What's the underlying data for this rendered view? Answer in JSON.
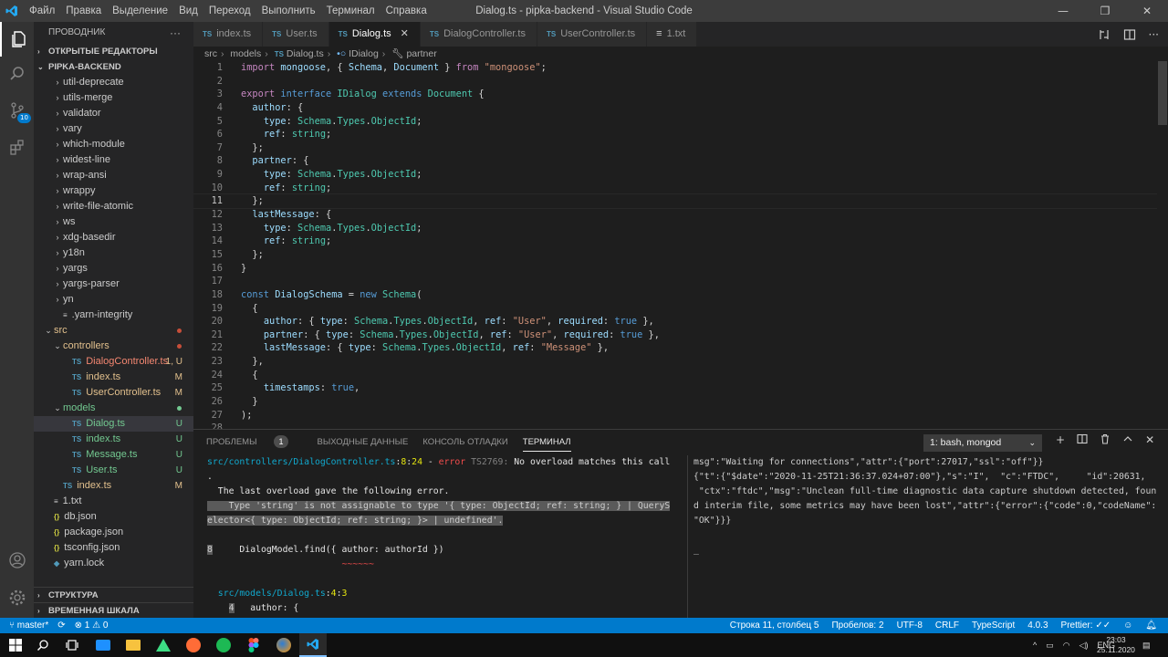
{
  "window": {
    "title": "Dialog.ts - pipka-backend - Visual Studio Code",
    "menu": [
      "Файл",
      "Правка",
      "Выделение",
      "Вид",
      "Переход",
      "Выполнить",
      "Терминал",
      "Справка"
    ],
    "controls": {
      "minimize": "—",
      "maximize": "❐",
      "close": "✕"
    }
  },
  "activity": {
    "scm_badge": "10"
  },
  "sidebar": {
    "title": "ПРОВОДНИК",
    "more": "···",
    "open_editors": "ОТКРЫТЫЕ РЕДАКТОРЫ",
    "project": "PIPKA-BACKEND",
    "outline": "СТРУКТУРА",
    "timeline": "ВРЕМЕННАЯ ШКАЛА",
    "items": [
      {
        "label": "util-deprecate",
        "type": "folder",
        "indent": 1
      },
      {
        "label": "utils-merge",
        "type": "folder",
        "indent": 1
      },
      {
        "label": "validator",
        "type": "folder",
        "indent": 1
      },
      {
        "label": "vary",
        "type": "folder",
        "indent": 1
      },
      {
        "label": "which-module",
        "type": "folder",
        "indent": 1
      },
      {
        "label": "widest-line",
        "type": "folder",
        "indent": 1
      },
      {
        "label": "wrap-ansi",
        "type": "folder",
        "indent": 1
      },
      {
        "label": "wrappy",
        "type": "folder",
        "indent": 1
      },
      {
        "label": "write-file-atomic",
        "type": "folder",
        "indent": 1
      },
      {
        "label": "ws",
        "type": "folder",
        "indent": 1
      },
      {
        "label": "xdg-basedir",
        "type": "folder",
        "indent": 1
      },
      {
        "label": "y18n",
        "type": "folder",
        "indent": 1
      },
      {
        "label": "yargs",
        "type": "folder",
        "indent": 1
      },
      {
        "label": "yargs-parser",
        "type": "folder",
        "indent": 1
      },
      {
        "label": "yn",
        "type": "folder",
        "indent": 1
      },
      {
        "label": ".yarn-integrity",
        "type": "file",
        "indent": 1
      },
      {
        "label": "src",
        "type": "open",
        "indent": 0,
        "color": "#e2c08d",
        "dot": "#c74e39"
      },
      {
        "label": "controllers",
        "type": "open",
        "indent": 1,
        "color": "#e2c08d",
        "dot": "#c74e39"
      },
      {
        "label": "DialogController.ts",
        "type": "ts",
        "indent": 2,
        "color": "#f48771",
        "badge": "1, U",
        "badgeColor": "#e2c08d"
      },
      {
        "label": "index.ts",
        "type": "ts",
        "indent": 2,
        "color": "#e2c08d",
        "badge": "M",
        "badgeColor": "#e2c08d"
      },
      {
        "label": "UserController.ts",
        "type": "ts",
        "indent": 2,
        "color": "#e2c08d",
        "badge": "M",
        "badgeColor": "#e2c08d"
      },
      {
        "label": "models",
        "type": "open",
        "indent": 1,
        "color": "#73c991",
        "dot": "#73c991"
      },
      {
        "label": "Dialog.ts",
        "type": "ts",
        "indent": 2,
        "color": "#73c991",
        "badge": "U",
        "badgeColor": "#73c991",
        "selected": true
      },
      {
        "label": "index.ts",
        "type": "ts",
        "indent": 2,
        "color": "#73c991",
        "badge": "U",
        "badgeColor": "#73c991"
      },
      {
        "label": "Message.ts",
        "type": "ts",
        "indent": 2,
        "color": "#73c991",
        "badge": "U",
        "badgeColor": "#73c991"
      },
      {
        "label": "User.ts",
        "type": "ts",
        "indent": 2,
        "color": "#73c991",
        "badge": "U",
        "badgeColor": "#73c991"
      },
      {
        "label": "index.ts",
        "type": "ts",
        "indent": 1,
        "color": "#e2c08d",
        "badge": "M",
        "badgeColor": "#e2c08d"
      },
      {
        "label": "1.txt",
        "type": "txt",
        "indent": 0
      },
      {
        "label": "db.json",
        "type": "json",
        "indent": 0
      },
      {
        "label": "package.json",
        "type": "json",
        "indent": 0
      },
      {
        "label": "tsconfig.json",
        "type": "json",
        "indent": 0
      },
      {
        "label": "yarn.lock",
        "type": "lock",
        "indent": 0
      }
    ]
  },
  "tabs": [
    {
      "label": "index.ts",
      "icon": "TS"
    },
    {
      "label": "User.ts",
      "icon": "TS"
    },
    {
      "label": "Dialog.ts",
      "icon": "TS",
      "active": true,
      "close": "✕"
    },
    {
      "label": "DialogController.ts",
      "icon": "TS"
    },
    {
      "label": "UserController.ts",
      "icon": "TS"
    },
    {
      "label": "1.txt",
      "icon": "≡"
    }
  ],
  "breadcrumb": [
    "src",
    "models",
    "Dialog.ts",
    "IDialog",
    "partner"
  ],
  "code": [
    [
      [
        "kw2",
        "import"
      ],
      [
        "pr",
        " mongoose"
      ],
      [
        "pu",
        ", { "
      ],
      [
        "pr",
        "Schema"
      ],
      [
        "pu",
        ", "
      ],
      [
        "pr",
        "Document"
      ],
      [
        "pu",
        " } "
      ],
      [
        "kw2",
        "from"
      ],
      [
        "pu",
        " "
      ],
      [
        "st",
        "\"mongoose\""
      ],
      [
        "pu",
        ";"
      ]
    ],
    [],
    [
      [
        "kw2",
        "export"
      ],
      [
        "pu",
        " "
      ],
      [
        "kw",
        "interface"
      ],
      [
        "pu",
        " "
      ],
      [
        "ty",
        "IDialog"
      ],
      [
        "pu",
        " "
      ],
      [
        "kw",
        "extends"
      ],
      [
        "pu",
        " "
      ],
      [
        "ty",
        "Document"
      ],
      [
        "pu",
        " {"
      ]
    ],
    [
      [
        "pu",
        "  "
      ],
      [
        "pr",
        "author"
      ],
      [
        "pu",
        ": {"
      ]
    ],
    [
      [
        "pu",
        "    "
      ],
      [
        "pr",
        "type"
      ],
      [
        "pu",
        ": "
      ],
      [
        "ty",
        "Schema"
      ],
      [
        "pu",
        "."
      ],
      [
        "ty",
        "Types"
      ],
      [
        "pu",
        "."
      ],
      [
        "ty",
        "ObjectId"
      ],
      [
        "pu",
        ";"
      ]
    ],
    [
      [
        "pu",
        "    "
      ],
      [
        "pr",
        "ref"
      ],
      [
        "pu",
        ": "
      ],
      [
        "ty",
        "string"
      ],
      [
        "pu",
        ";"
      ]
    ],
    [
      [
        "pu",
        "  };"
      ]
    ],
    [
      [
        "pu",
        "  "
      ],
      [
        "pr",
        "partner"
      ],
      [
        "pu",
        ": {"
      ]
    ],
    [
      [
        "pu",
        "    "
      ],
      [
        "pr",
        "type"
      ],
      [
        "pu",
        ": "
      ],
      [
        "ty",
        "Schema"
      ],
      [
        "pu",
        "."
      ],
      [
        "ty",
        "Types"
      ],
      [
        "pu",
        "."
      ],
      [
        "ty",
        "ObjectId"
      ],
      [
        "pu",
        ";"
      ]
    ],
    [
      [
        "pu",
        "    "
      ],
      [
        "pr",
        "ref"
      ],
      [
        "pu",
        ": "
      ],
      [
        "ty",
        "string"
      ],
      [
        "pu",
        ";"
      ]
    ],
    [
      [
        "pu",
        "  };"
      ]
    ],
    [
      [
        "pu",
        "  "
      ],
      [
        "pr",
        "lastMessage"
      ],
      [
        "pu",
        ": {"
      ]
    ],
    [
      [
        "pu",
        "    "
      ],
      [
        "pr",
        "type"
      ],
      [
        "pu",
        ": "
      ],
      [
        "ty",
        "Schema"
      ],
      [
        "pu",
        "."
      ],
      [
        "ty",
        "Types"
      ],
      [
        "pu",
        "."
      ],
      [
        "ty",
        "ObjectId"
      ],
      [
        "pu",
        ";"
      ]
    ],
    [
      [
        "pu",
        "    "
      ],
      [
        "pr",
        "ref"
      ],
      [
        "pu",
        ": "
      ],
      [
        "ty",
        "string"
      ],
      [
        "pu",
        ";"
      ]
    ],
    [
      [
        "pu",
        "  };"
      ]
    ],
    [
      [
        "pu",
        "}"
      ]
    ],
    [],
    [
      [
        "kw",
        "const"
      ],
      [
        "pu",
        " "
      ],
      [
        "pr",
        "DialogSchema"
      ],
      [
        "pu",
        " = "
      ],
      [
        "kw",
        "new"
      ],
      [
        "pu",
        " "
      ],
      [
        "ty",
        "Schema"
      ],
      [
        "pu",
        "("
      ]
    ],
    [
      [
        "pu",
        "  {"
      ]
    ],
    [
      [
        "pu",
        "    "
      ],
      [
        "pr",
        "author"
      ],
      [
        "pu",
        ": { "
      ],
      [
        "pr",
        "type"
      ],
      [
        "pu",
        ": "
      ],
      [
        "ty",
        "Schema"
      ],
      [
        "pu",
        "."
      ],
      [
        "ty",
        "Types"
      ],
      [
        "pu",
        "."
      ],
      [
        "ty",
        "ObjectId"
      ],
      [
        "pu",
        ", "
      ],
      [
        "pr",
        "ref"
      ],
      [
        "pu",
        ": "
      ],
      [
        "st",
        "\"User\""
      ],
      [
        "pu",
        ", "
      ],
      [
        "pr",
        "required"
      ],
      [
        "pu",
        ": "
      ],
      [
        "kw",
        "true"
      ],
      [
        "pu",
        " },"
      ]
    ],
    [
      [
        "pu",
        "    "
      ],
      [
        "pr",
        "partner"
      ],
      [
        "pu",
        ": { "
      ],
      [
        "pr",
        "type"
      ],
      [
        "pu",
        ": "
      ],
      [
        "ty",
        "Schema"
      ],
      [
        "pu",
        "."
      ],
      [
        "ty",
        "Types"
      ],
      [
        "pu",
        "."
      ],
      [
        "ty",
        "ObjectId"
      ],
      [
        "pu",
        ", "
      ],
      [
        "pr",
        "ref"
      ],
      [
        "pu",
        ": "
      ],
      [
        "st",
        "\"User\""
      ],
      [
        "pu",
        ", "
      ],
      [
        "pr",
        "required"
      ],
      [
        "pu",
        ": "
      ],
      [
        "kw",
        "true"
      ],
      [
        "pu",
        " },"
      ]
    ],
    [
      [
        "pu",
        "    "
      ],
      [
        "pr",
        "lastMessage"
      ],
      [
        "pu",
        ": { "
      ],
      [
        "pr",
        "type"
      ],
      [
        "pu",
        ": "
      ],
      [
        "ty",
        "Schema"
      ],
      [
        "pu",
        "."
      ],
      [
        "ty",
        "Types"
      ],
      [
        "pu",
        "."
      ],
      [
        "ty",
        "ObjectId"
      ],
      [
        "pu",
        ", "
      ],
      [
        "pr",
        "ref"
      ],
      [
        "pu",
        ": "
      ],
      [
        "st",
        "\"Message\""
      ],
      [
        "pu",
        " },"
      ]
    ],
    [
      [
        "pu",
        "  },"
      ]
    ],
    [
      [
        "pu",
        "  {"
      ]
    ],
    [
      [
        "pu",
        "    "
      ],
      [
        "pr",
        "timestamps"
      ],
      [
        "pu",
        ": "
      ],
      [
        "kw",
        "true"
      ],
      [
        "pu",
        ","
      ]
    ],
    [
      [
        "pu",
        "  }"
      ]
    ],
    [
      [
        "pu",
        ");"
      ]
    ],
    []
  ],
  "current_line": 11,
  "panel": {
    "tabs": [
      "ПРОБЛЕМЫ",
      "ВЫХОДНЫЕ ДАННЫЕ",
      "КОНСОЛЬ ОТЛАДКИ",
      "ТЕРМИНАЛ"
    ],
    "problems_count": "1",
    "terminal_select": "1: bash, mongod",
    "term1": [
      [
        [
          "cy",
          "src/controllers/DialogController.ts"
        ],
        [
          "tk",
          ":"
        ],
        [
          "yl",
          "8"
        ],
        [
          "tk",
          ":"
        ],
        [
          "yl",
          "24"
        ],
        [
          "tk",
          " - "
        ],
        [
          "rd",
          "error"
        ],
        [
          "gr",
          " TS2769: "
        ],
        [
          "tk",
          "No overload matches this call"
        ]
      ],
      [
        [
          "tk",
          "."
        ]
      ],
      [
        [
          "tk",
          "  The last overload gave the following error."
        ]
      ],
      [
        [
          "hl",
          "    Type 'string' is not assignable to type '{ type: ObjectId; ref: string; } | QueryS"
        ]
      ],
      [
        [
          "hl",
          "elector<{ type: ObjectId; ref: string; }> | undefined'."
        ]
      ],
      [],
      [
        [
          "hl",
          "8"
        ],
        [
          "tk",
          "     DialogModel.find({ author: authorId })"
        ]
      ],
      [
        [
          "rd",
          "                         ~~~~~~"
        ]
      ],
      [],
      [
        [
          "cy",
          "  src/models/Dialog.ts"
        ],
        [
          "tk",
          ":"
        ],
        [
          "yl",
          "4"
        ],
        [
          "tk",
          ":"
        ],
        [
          "yl",
          "3"
        ]
      ],
      [
        [
          "tk",
          "    "
        ],
        [
          "hl",
          "4"
        ],
        [
          "tk",
          "   author: {"
        ]
      ]
    ],
    "term2": [
      "msg\":\"Waiting for connections\",\"attr\":{\"port\":27017,\"ssl\":\"off\"}}",
      "{\"t\":{\"$date\":\"2020-11-25T21:36:37.024+07:00\"},\"s\":\"I\",  \"c\":\"FTDC\",     \"id\":20631,",
      " \"ctx\":\"ftdc\",\"msg\":\"Unclean full-time diagnostic data capture shutdown detected, foun",
      "d interim file, some metrics may have been lost\",\"attr\":{\"error\":{\"code\":0,\"codeName\":",
      "\"OK\"}}}",
      "",
      "_"
    ]
  },
  "status": {
    "branch": "master*",
    "sync": "⟳",
    "errors": "⊗ 1 ⚠ 0",
    "position": "Строка 11, столбец 5",
    "spaces": "Пробелов: 2",
    "encoding": "UTF-8",
    "eol": "CRLF",
    "language": "TypeScript",
    "version": "4.0.3",
    "prettier": "Prettier: ✓✓"
  },
  "taskbar": {
    "lang": "ENG",
    "time": "23:03",
    "date": "25.11.2020"
  }
}
